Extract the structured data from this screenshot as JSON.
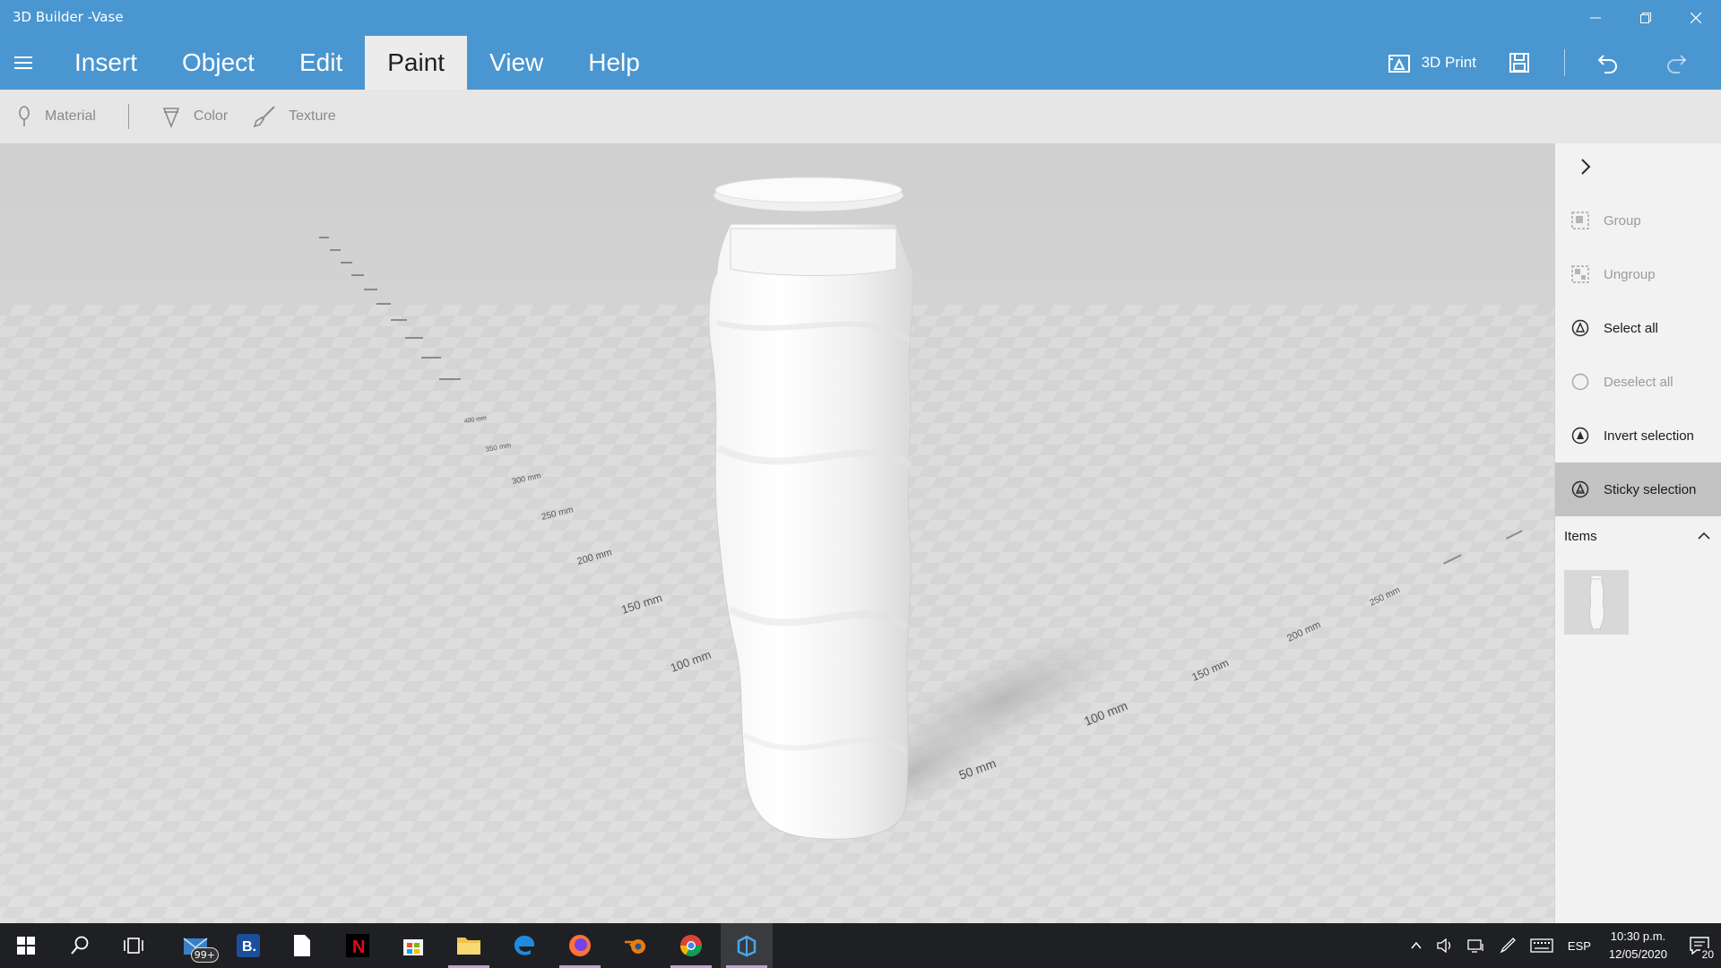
{
  "window": {
    "title": "3D Builder -Vase"
  },
  "menu": {
    "tabs": [
      {
        "label": "Insert"
      },
      {
        "label": "Object"
      },
      {
        "label": "Edit"
      },
      {
        "label": "Paint"
      },
      {
        "label": "View"
      },
      {
        "label": "Help"
      }
    ],
    "active": "Paint",
    "print_label": "3D Print"
  },
  "ribbon": {
    "material": "Material",
    "color": "Color",
    "texture": "Texture"
  },
  "panel": {
    "items": [
      {
        "label": "Group",
        "state": "disabled"
      },
      {
        "label": "Ungroup",
        "state": "disabled"
      },
      {
        "label": "Select all",
        "state": "enabled"
      },
      {
        "label": "Deselect all",
        "state": "disabled"
      },
      {
        "label": "Invert selection",
        "state": "enabled"
      },
      {
        "label": "Sticky selection",
        "state": "active"
      }
    ],
    "items_header": "Items"
  },
  "ruler_left": [
    "100 mm",
    "150 mm",
    "200 mm",
    "250 mm",
    "300 mm",
    "350 mm",
    "400 mm"
  ],
  "ruler_right": [
    "50 mm",
    "100 mm",
    "150 mm",
    "200 mm",
    "250 mm"
  ],
  "taskbar": {
    "mail_badge": "99+",
    "lang": "ESP",
    "time": "10:30 p.m.",
    "date": "12/05/2020",
    "notifications": "20"
  },
  "colors": {
    "accent": "#4a96d0",
    "ribbon": "#e6e6e6",
    "panel": "#f2f2f2",
    "taskbar": "#1f2023"
  }
}
